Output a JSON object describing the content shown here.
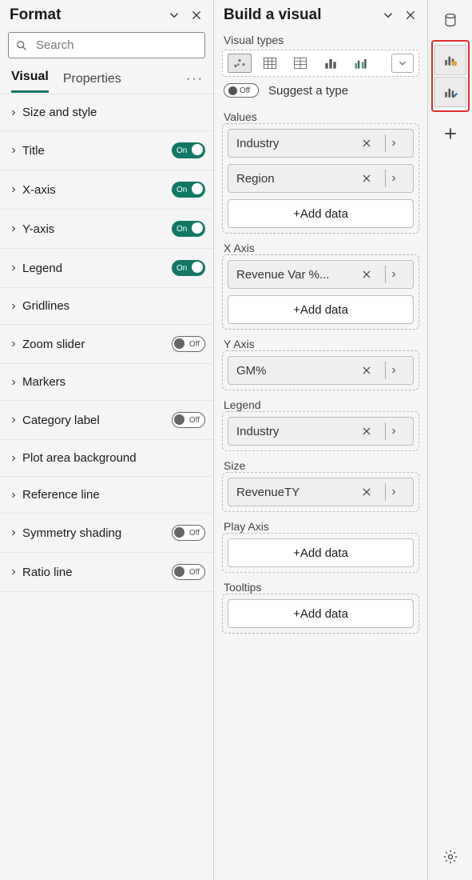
{
  "format": {
    "title": "Format",
    "searchPlaceholder": "Search",
    "tabs": {
      "visual": "Visual",
      "properties": "Properties"
    },
    "cards": [
      {
        "label": "Size and style"
      },
      {
        "label": "Title",
        "toggle": "On"
      },
      {
        "label": "X-axis",
        "toggle": "On"
      },
      {
        "label": "Y-axis",
        "toggle": "On"
      },
      {
        "label": "Legend",
        "toggle": "On"
      },
      {
        "label": "Gridlines"
      },
      {
        "label": "Zoom slider",
        "toggle": "Off"
      },
      {
        "label": "Markers"
      },
      {
        "label": "Category label",
        "toggle": "Off"
      },
      {
        "label": "Plot area background"
      },
      {
        "label": "Reference line"
      },
      {
        "label": "Symmetry shading",
        "toggle": "Off"
      },
      {
        "label": "Ratio line",
        "toggle": "Off"
      }
    ]
  },
  "build": {
    "title": "Build a visual",
    "visualTypesLabel": "Visual types",
    "suggestToggle": "Off",
    "suggestLabel": "Suggest a type",
    "addData": "+Add data",
    "wells": [
      {
        "label": "Values",
        "fields": [
          "Industry",
          "Region"
        ],
        "add": true
      },
      {
        "label": "X Axis",
        "fields": [
          "Revenue Var %..."
        ],
        "add": true
      },
      {
        "label": "Y Axis",
        "fields": [
          "GM%"
        ],
        "add": false
      },
      {
        "label": "Legend",
        "fields": [
          "Industry"
        ],
        "add": false
      },
      {
        "label": "Size",
        "fields": [
          "RevenueTY"
        ],
        "add": false
      },
      {
        "label": "Play Axis",
        "fields": [],
        "add": true
      },
      {
        "label": "Tooltips",
        "fields": [],
        "add": true
      }
    ]
  }
}
